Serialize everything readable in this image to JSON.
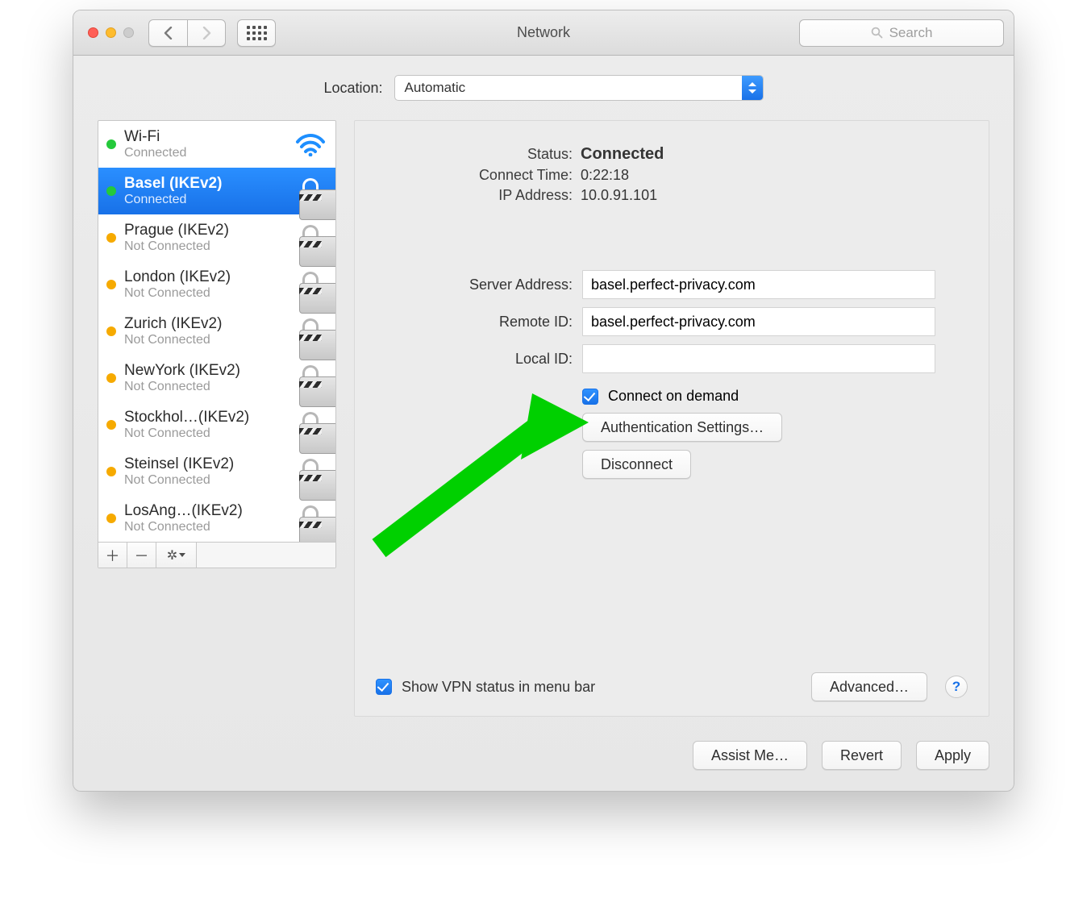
{
  "window": {
    "title": "Network",
    "search_placeholder": "Search"
  },
  "location": {
    "label": "Location:",
    "value": "Automatic"
  },
  "sidebar": {
    "items": [
      {
        "name": "Wi-Fi",
        "sub": "Connected",
        "status": "green",
        "icon": "wifi"
      },
      {
        "name": "Basel (IKEv2)",
        "sub": "Connected",
        "status": "green",
        "icon": "vpn",
        "selected": true
      },
      {
        "name": "Prague (IKEv2)",
        "sub": "Not Connected",
        "status": "orange",
        "icon": "vpn"
      },
      {
        "name": "London (IKEv2)",
        "sub": "Not Connected",
        "status": "orange",
        "icon": "vpn"
      },
      {
        "name": "Zurich (IKEv2)",
        "sub": "Not Connected",
        "status": "orange",
        "icon": "vpn"
      },
      {
        "name": "NewYork (IKEv2)",
        "sub": "Not Connected",
        "status": "orange",
        "icon": "vpn"
      },
      {
        "name": "Stockhol…(IKEv2)",
        "sub": "Not Connected",
        "status": "orange",
        "icon": "vpn"
      },
      {
        "name": "Steinsel (IKEv2)",
        "sub": "Not Connected",
        "status": "orange",
        "icon": "vpn"
      },
      {
        "name": "LosAng…(IKEv2)",
        "sub": "Not Connected",
        "status": "orange",
        "icon": "vpn"
      }
    ]
  },
  "detail": {
    "status_label": "Status:",
    "status_value": "Connected",
    "connect_time_label": "Connect Time:",
    "connect_time_value": "0:22:18",
    "ip_label": "IP Address:",
    "ip_value": "10.0.91.101",
    "server_address_label": "Server Address:",
    "server_address_value": "basel.perfect-privacy.com",
    "remote_id_label": "Remote ID:",
    "remote_id_value": "basel.perfect-privacy.com",
    "local_id_label": "Local ID:",
    "local_id_value": "",
    "connect_on_demand_label": "Connect on demand",
    "connect_on_demand_checked": true,
    "auth_btn": "Authentication Settings…",
    "disconnect_btn": "Disconnect",
    "show_vpn_label": "Show VPN status in menu bar",
    "show_vpn_checked": true,
    "advanced_btn": "Advanced…"
  },
  "footer": {
    "assist": "Assist Me…",
    "revert": "Revert",
    "apply": "Apply"
  }
}
